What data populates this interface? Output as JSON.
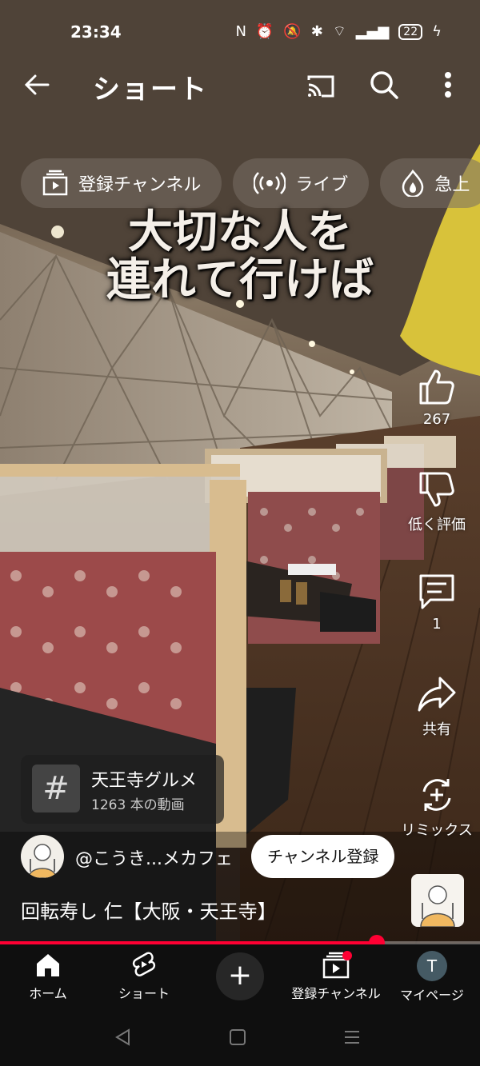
{
  "status_bar": {
    "time": "23:34",
    "battery": "22"
  },
  "top_bar": {
    "title": "ショート"
  },
  "chips": [
    {
      "label": "登録チャンネル",
      "icon": "subscriptions-icon"
    },
    {
      "label": "ライブ",
      "icon": "live-icon"
    },
    {
      "label": "急上",
      "icon": "trending-icon"
    }
  ],
  "caption": {
    "line1": "大切な人を",
    "line2": "連れて行けば"
  },
  "actions": {
    "like_count": "267",
    "dislike_label": "低く評価",
    "comment_count": "1",
    "share_label": "共有",
    "remix_label": "リミックス"
  },
  "hashtag": {
    "name": "天王寺グルメ",
    "count": "1263 本の動画"
  },
  "channel": {
    "handle": "@こうき...メカフェ",
    "subscribe_label": "チャンネル登録"
  },
  "video": {
    "title": "回転寿し 仁【大阪・天王寺】",
    "progress": 0.785
  },
  "nav": {
    "home": "ホーム",
    "shorts": "ショート",
    "subscriptions": "登録チャンネル",
    "you": "マイページ",
    "avatar_letter": "T"
  },
  "colors": {
    "accent": "#ff0033",
    "nav_bg": "#0f0f0f"
  }
}
